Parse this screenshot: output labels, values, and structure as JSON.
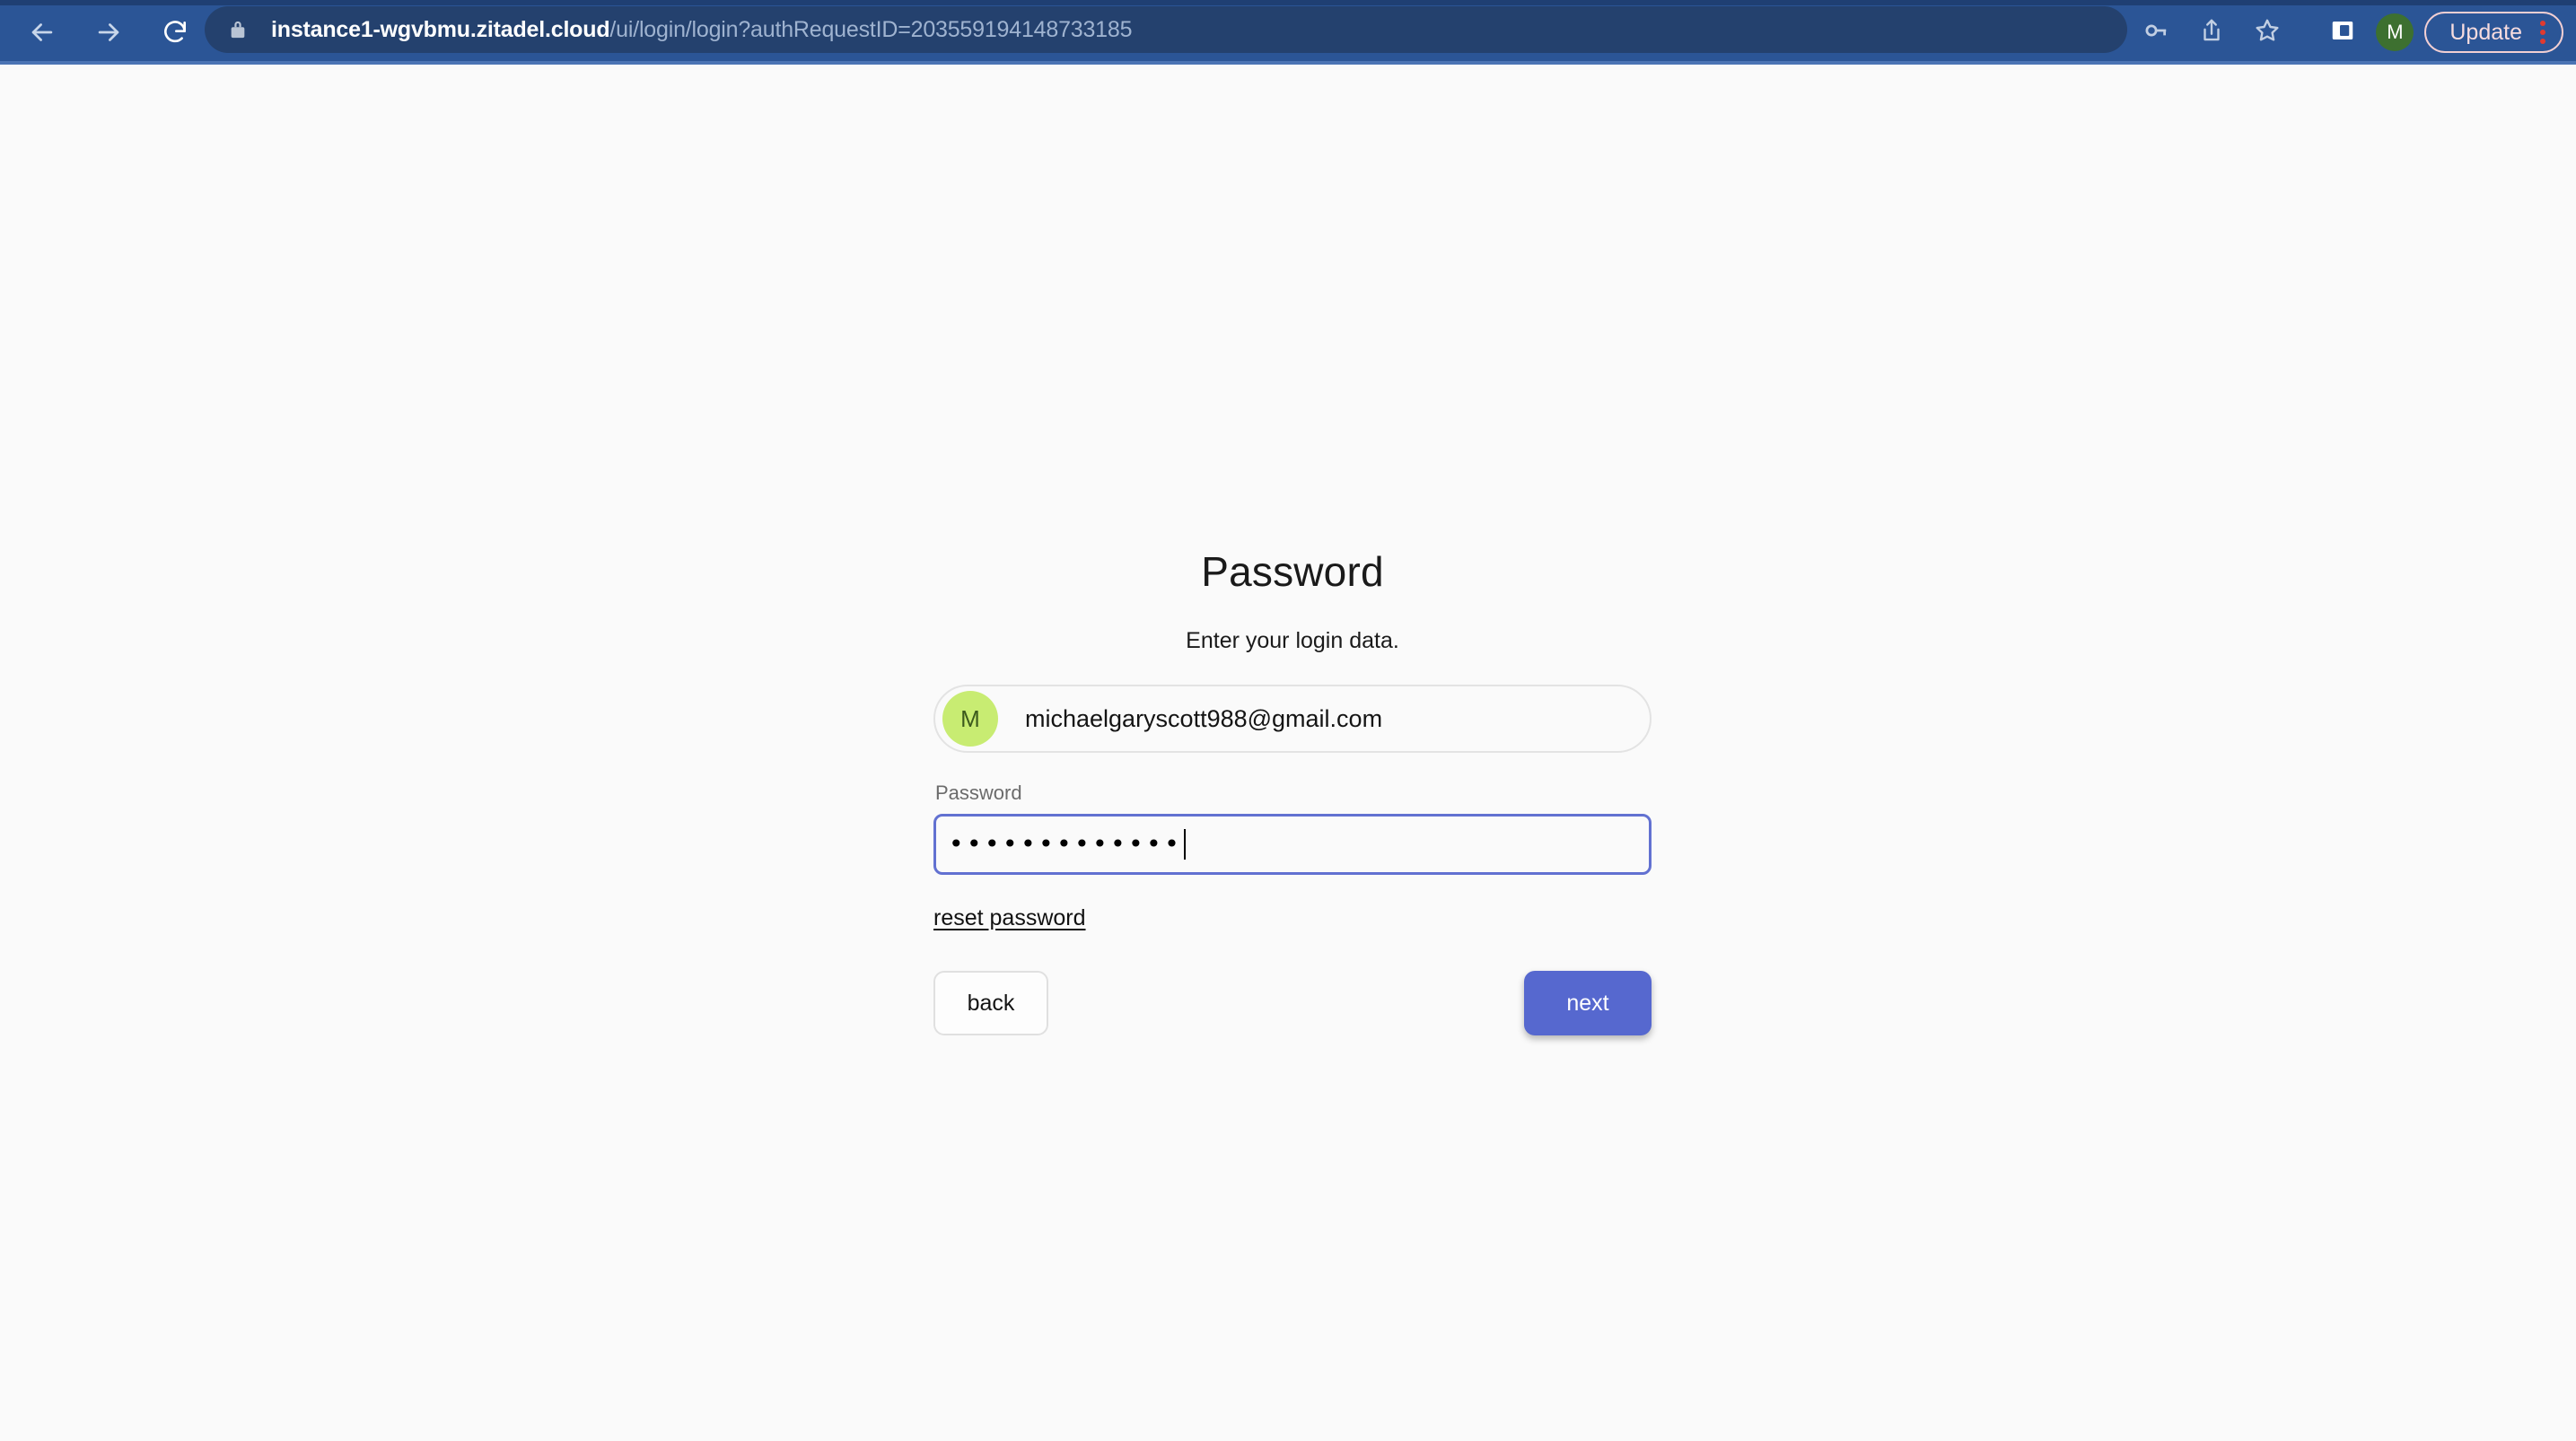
{
  "browser": {
    "nav": {
      "back_icon": "arrow-left-icon",
      "forward_icon": "arrow-right-icon",
      "reload_icon": "reload-icon"
    },
    "address_bar": {
      "lock_icon": "lock-icon",
      "host": "instance1-wgvbmu.zitadel.cloud",
      "path": "/ui/login/login?authRequestID=203559194148733185",
      "full_url": "instance1-wgvbmu.zitadel.cloud/ui/login/login?authRequestID=203559194148733185"
    },
    "toolbar": {
      "password_manager_icon": "key-icon",
      "share_icon": "share-icon",
      "bookmark_icon": "star-icon",
      "side_panel_icon": "side-panel-icon",
      "profile_initial": "M",
      "update_label": "Update",
      "menu_icon": "kebab-menu-icon"
    },
    "colors": {
      "toolbar_bg": "#2b5596",
      "address_pill_bg": "#24416e",
      "profile_avatar_bg": "#3d7030",
      "update_accent": "#f2cfd3",
      "menu_dot": "#e03a2f"
    }
  },
  "page": {
    "title": "Password",
    "subtitle": "Enter your login data.",
    "user": {
      "avatar_initial": "M",
      "avatar_color": "#c8ec72",
      "email": "michaelgaryscott988@gmail.com"
    },
    "password_field": {
      "label": "Password",
      "value_masked": "•••••••••••••",
      "placeholder": "Password",
      "focused": true,
      "focus_color": "#6271d1"
    },
    "reset_link": "reset password",
    "buttons": {
      "back_label": "back",
      "next_label": "next",
      "next_color": "#5668cf"
    },
    "background": "#fafafa"
  }
}
